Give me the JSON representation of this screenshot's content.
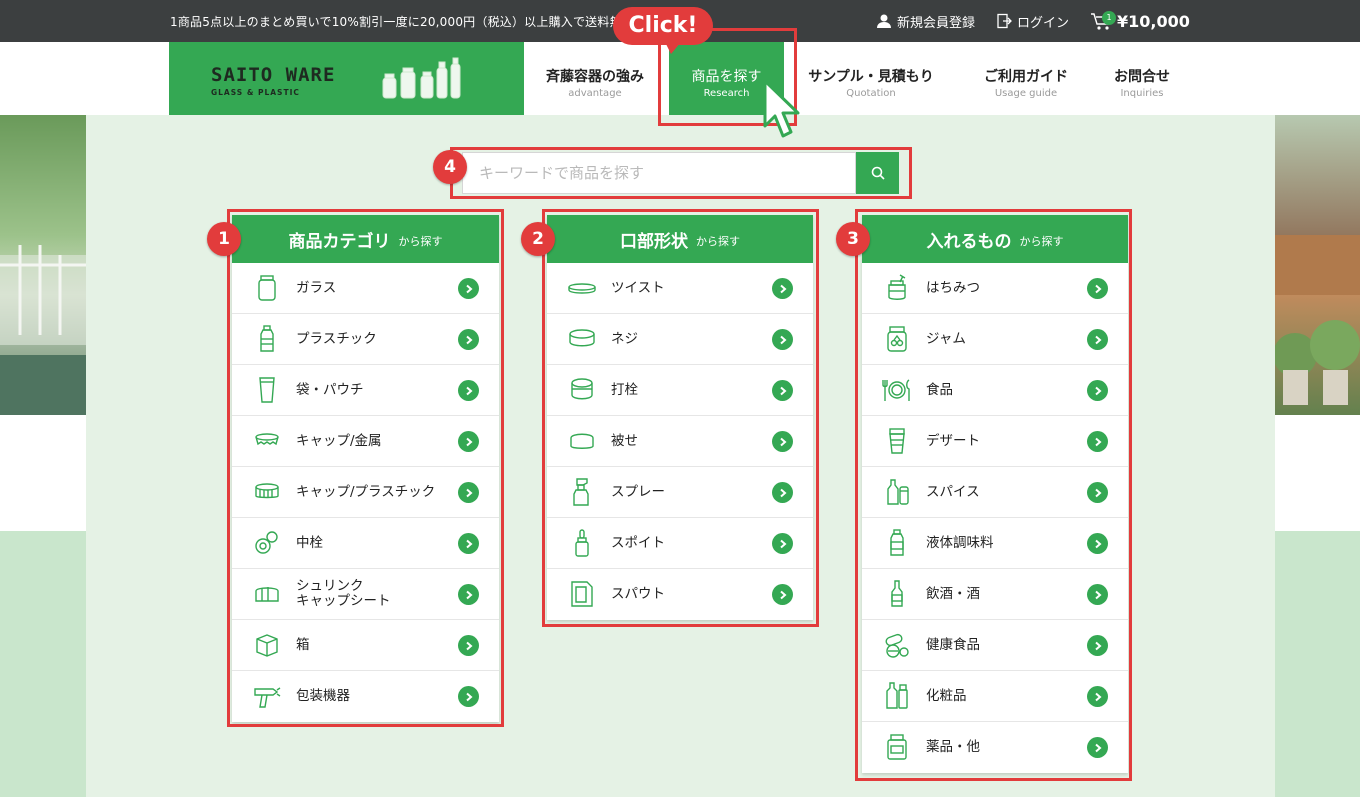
{
  "topbar": {
    "promo": "1商品5点以上のまとめ買いで10%割引一度に20,000円（税込）以上購入で送料無料",
    "register": "新規会員登録",
    "login": "ログイン",
    "cart_count": "1",
    "cart_total": "¥10,000"
  },
  "logo": {
    "name": "SAITO WARE",
    "sub": "GLASS & PLASTIC"
  },
  "nav": [
    {
      "jp": "斉藤容器の強み",
      "en": "advantage"
    },
    {
      "jp": "商品を探す",
      "en": "Research"
    },
    {
      "jp": "サンプル・見積もり",
      "en": "Quotation"
    },
    {
      "jp": "ご利用ガイド",
      "en": "Usage guide"
    },
    {
      "jp": "お問合せ",
      "en": "Inquiries"
    }
  ],
  "annotations": {
    "click": "Click!",
    "n1": "1",
    "n2": "2",
    "n3": "3",
    "n4": "4"
  },
  "search": {
    "placeholder": "キーワードで商品を探す"
  },
  "cards": [
    {
      "title": "商品カテゴリ",
      "suffix": "から探す",
      "items": [
        "ガラス",
        "プラスチック",
        "袋・パウチ",
        "キャップ/金属",
        "キャップ/プラスチック",
        "中栓",
        "シュリンク\nキャップシート",
        "箱",
        "包装機器"
      ]
    },
    {
      "title": "口部形状",
      "suffix": "から探す",
      "items": [
        "ツイスト",
        "ネジ",
        "打栓",
        "被せ",
        "スプレー",
        "スポイト",
        "スパウト"
      ]
    },
    {
      "title": "入れるもの",
      "suffix": "から探す",
      "items": [
        "はちみつ",
        "ジャム",
        "食品",
        "デザート",
        "スパイス",
        "液体調味料",
        "飲酒・酒",
        "健康食品",
        "化粧品",
        "薬品・他"
      ]
    }
  ],
  "colors": {
    "accent": "#34a853",
    "highlight": "#e23c3c",
    "topbar": "#3c3f40",
    "panel": "#e5f2e5"
  }
}
